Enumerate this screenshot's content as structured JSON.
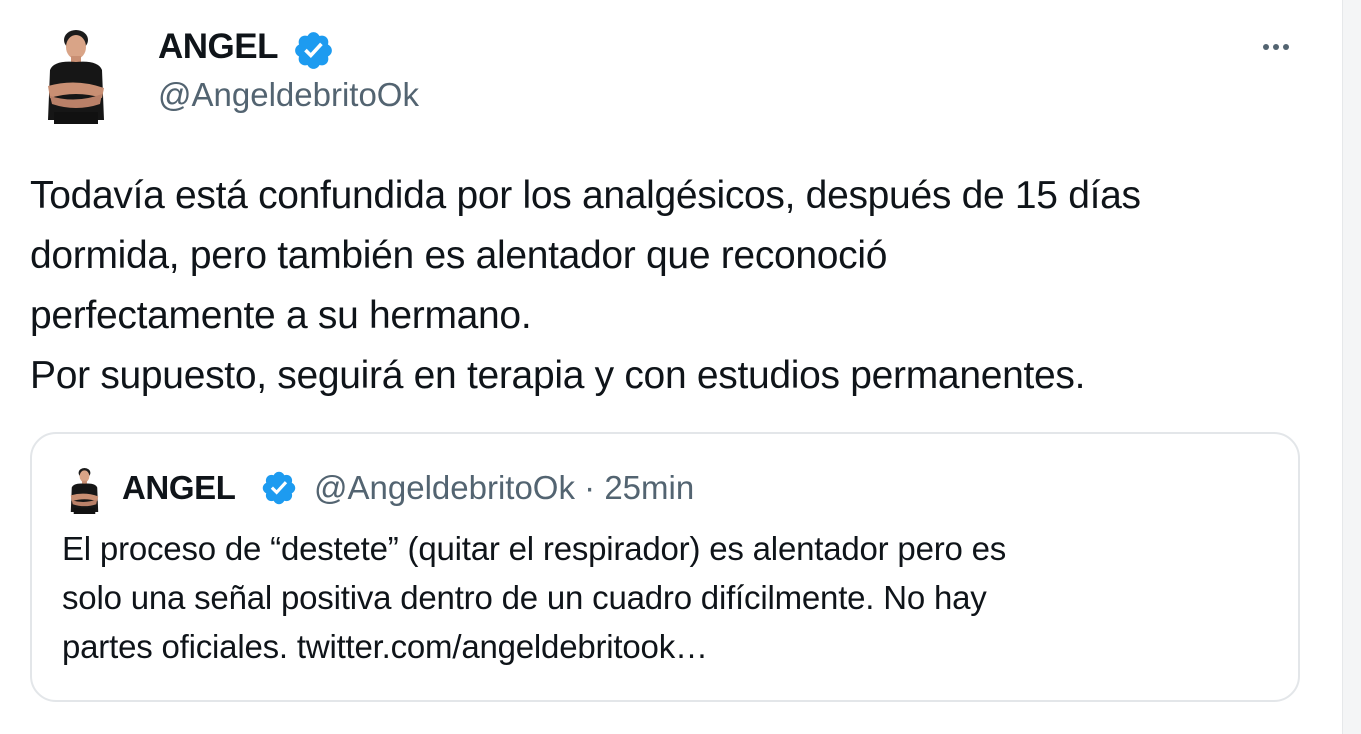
{
  "tweet": {
    "author_name": "ANGEL",
    "author_handle": "@AngeldebritoOk",
    "more_label": "···",
    "text_lines": [
      "Todavía está confundida por los analgésicos, después de 15 días",
      "dormida, pero también es alentador que reconoció",
      "perfectamente a su hermano.",
      "Por supuesto, seguirá en terapia y con estudios permanentes."
    ]
  },
  "quoted_tweet": {
    "author_name": "ANGEL",
    "author_handle": "@AngeldebritoOk",
    "separator": "·",
    "timestamp": "25min",
    "text_lines": [
      "El proceso de “destete” (quitar el respirador) es alentador pero es",
      "solo una señal positiva dentro de un cuadro difícilmente. No hay",
      "partes oficiales. twitter.com/angeldebritook…"
    ]
  },
  "icons": {
    "verified": "verified-badge-icon",
    "more": "more-options-icon",
    "avatar": "avatar-photo"
  },
  "colors": {
    "verified_blue": "#1d9bf0",
    "text_primary": "#0f1419",
    "text_secondary": "#536471",
    "border": "#e3e6e9"
  }
}
